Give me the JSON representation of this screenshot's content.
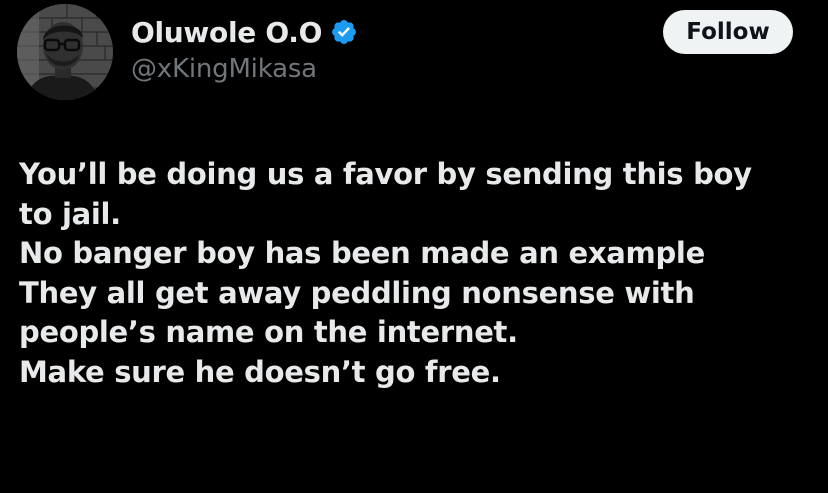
{
  "tweet": {
    "author": {
      "display_name": "Oluwole O.O",
      "handle": "@xKingMikasa",
      "verified": true,
      "verified_color": "#1d9bf0"
    },
    "follow_label": "Follow",
    "text_lines": [
      "You’ll be doing us a favor by sending this boy",
      "to jail.",
      "No banger boy has been made an example",
      "They all get away peddling nonsense with",
      "people’s name on the internet.",
      "Make sure he doesn’t go free."
    ]
  },
  "colors": {
    "background": "#000000",
    "primary_text": "#e7e9ea",
    "secondary_text": "#71767b",
    "follow_bg": "#eff3f4",
    "follow_text": "#0f1419"
  },
  "icons": {
    "avatar": "profile-photo",
    "verified": "verified-badge-icon"
  }
}
